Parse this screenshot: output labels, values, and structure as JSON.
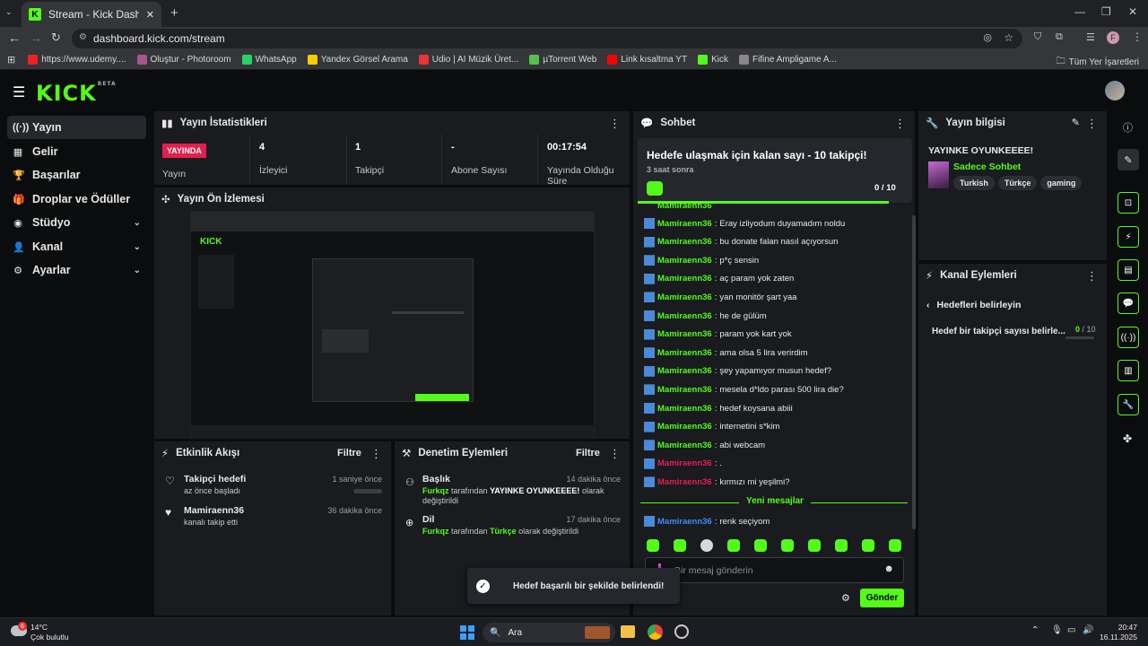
{
  "browser": {
    "tab_title": "Stream - Kick Dashboard",
    "url": "dashboard.kick.com/stream",
    "bookmarks": [
      {
        "label": "https://www.udemy....",
        "color": "#e22"
      },
      {
        "label": "Oluştur - Photoroom",
        "color": "#a58"
      },
      {
        "label": "WhatsApp",
        "color": "#25d366"
      },
      {
        "label": "Yandex Görsel Arama",
        "color": "#fc0"
      },
      {
        "label": "Udio | AI Müzik Üret...",
        "color": "#e33"
      },
      {
        "label": "µTorrent Web",
        "color": "#53c24b"
      },
      {
        "label": "Link kısaltma YT",
        "color": "#f00"
      },
      {
        "label": "Kick",
        "color": "#53fc18"
      },
      {
        "label": "Fifine Ampligame A...",
        "color": "#888"
      }
    ],
    "all_bookmarks": "Tüm Yer İşaretleri",
    "profile_letter": "F"
  },
  "kick": {
    "logo": "KICK",
    "beta": "BETA"
  },
  "sidebar": {
    "items": [
      {
        "label": "Yayın",
        "icon": "((·))"
      },
      {
        "label": "Gelir",
        "icon": "▦"
      },
      {
        "label": "Başarılar",
        "icon": "🏆"
      },
      {
        "label": "Droplar ve Ödüller",
        "icon": "🎁"
      },
      {
        "label": "Stüdyo",
        "icon": "◉"
      },
      {
        "label": "Kanal",
        "icon": "👤"
      },
      {
        "label": "Ayarlar",
        "icon": "⚙"
      }
    ]
  },
  "stats": {
    "title": "Yayın İstatistikleri",
    "live_badge": "YAYINDA",
    "live_label": "Yayın",
    "viewers_value": "4",
    "viewers_label": "İzleyici",
    "followers_value": "1",
    "followers_label": "Takipçi",
    "subs_value": "-",
    "subs_label": "Abone Sayısı",
    "time_value": "00:17:54",
    "time_label": "Yayında Olduğu Süre"
  },
  "preview": {
    "title": "Yayın Ön İzlemesi"
  },
  "activity": {
    "title": "Etkinlik Akışı",
    "filter": "Filtre",
    "items": [
      {
        "title": "Takipçi hedefi",
        "sub": "az önce başladı",
        "time": "1 saniye önce"
      },
      {
        "title": "Mamiraenn36",
        "sub": "kanalı takip etti",
        "time": "36 dakika önce"
      }
    ]
  },
  "moderation": {
    "title": "Denetim Eylemleri",
    "filter": "Filtre",
    "items": [
      {
        "title": "Başlık",
        "time": "14 dakika önce",
        "by": "Furkqz",
        "mid": " tarafından ",
        "value": "YAYINKE OYUNKEEEE!",
        "end": " olarak değiştirildi"
      },
      {
        "title": "Dil",
        "time": "17 dakika önce",
        "by": "Furkqz",
        "mid": " tarafından ",
        "value": "Türkçe",
        "end": " olarak değiştirildi"
      }
    ]
  },
  "chat": {
    "title": "Sohbet",
    "goal_title": "Hedefe ulaşmak için kalan sayı - 10 takipçi!",
    "goal_time": "3 saat sonra",
    "goal_progress": "0 / 10",
    "messages": [
      {
        "user": "Mamiraenn36",
        "text": "Eray izliyodum duyamadım noldu",
        "c": ""
      },
      {
        "user": "Mamiraenn36",
        "text": "bu donate falan nasıl açıyorsun",
        "c": ""
      },
      {
        "user": "Mamiraenn36",
        "text": "p*ç sensin",
        "c": ""
      },
      {
        "user": "Mamiraenn36",
        "text": "aç param yok zaten",
        "c": ""
      },
      {
        "user": "Mamiraenn36",
        "text": "yan monitör şart yaa",
        "c": ""
      },
      {
        "user": "Mamiraenn36",
        "text": "he de gülüm",
        "c": ""
      },
      {
        "user": "Mamiraenn36",
        "text": "param yok kart yok",
        "c": ""
      },
      {
        "user": "Mamiraenn36",
        "text": "ama olsa 5 lira verirdim",
        "c": ""
      },
      {
        "user": "Mamiraenn36",
        "text": "şey yapamıyor musun hedef?",
        "c": ""
      },
      {
        "user": "Mamiraenn36",
        "text": "mesela d*ldo parası 500 lira die?",
        "c": ""
      },
      {
        "user": "Mamiraenn36",
        "text": "hedef koysana abiii",
        "c": ""
      },
      {
        "user": "Mamiraenn36",
        "text": "internetini s*kim",
        "c": ""
      },
      {
        "user": "Mamiraenn36",
        "text": "abi webcam",
        "c": ""
      },
      {
        "user": "Mamiraenn36",
        "text": ".",
        "c": "red"
      },
      {
        "user": "Mamiraenn36",
        "text": "kırmızı mi yeşilmi?",
        "c": "red"
      }
    ],
    "new_messages": "Yeni mesajlar",
    "last_message": {
      "user": "Mamiraenn36",
      "text": "renk seçiyom"
    },
    "input_placeholder": "Bir mesaj gönderin",
    "send": "Gönder"
  },
  "stream_info": {
    "title": "Yayın bilgisi",
    "stream_title": "YAYINKE OYUNKEEEE!",
    "category": "Sadece Sohbet",
    "tags": [
      "Turkish",
      "Türkçe",
      "gaming"
    ]
  },
  "channel_actions": {
    "title": "Kanal Eylemleri",
    "back": "Hedefleri belirleyin",
    "goal": "Hedef bir takipçi sayısı belirle...",
    "goal_current": "0",
    "goal_total": " / 10",
    "goal_fraction": 0.0
  },
  "toast": {
    "text": "Hedef başarılı bir şekilde belirlendi!"
  },
  "taskbar": {
    "weather_temp": "14°C",
    "weather_desc": "Çok bulutlu",
    "weather_badge": "6",
    "search": "Ara",
    "time": "20:47",
    "date": "16.11.2025"
  }
}
